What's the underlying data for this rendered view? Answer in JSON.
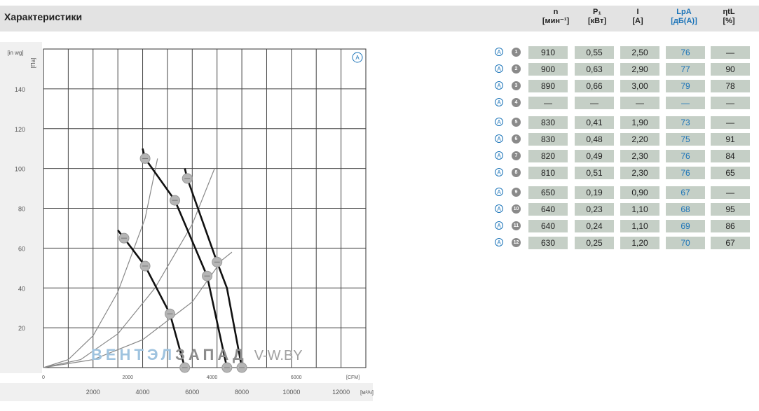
{
  "header": {
    "title": "Характеристики",
    "columns": [
      {
        "id": "n",
        "label": "n",
        "unit": "[мин⁻¹]",
        "color": "#222222"
      },
      {
        "id": "p1",
        "label": "P₁",
        "unit": "[кВт]",
        "color": "#222222"
      },
      {
        "id": "i",
        "label": "I",
        "unit": "[A]",
        "color": "#222222"
      },
      {
        "id": "lpa",
        "label": "LpA",
        "unit": "[дБ(A)]",
        "color": "#1a73b8"
      },
      {
        "id": "eta",
        "label": "ηtL",
        "unit": "[%]",
        "color": "#222222"
      }
    ]
  },
  "table": {
    "mark": "A",
    "rows": [
      {
        "idx": "1",
        "n": "910",
        "p1": "0,55",
        "i": "2,50",
        "lpa": "76",
        "eta": "—"
      },
      {
        "idx": "2",
        "n": "900",
        "p1": "0,63",
        "i": "2,90",
        "lpa": "77",
        "eta": "90"
      },
      {
        "idx": "3",
        "n": "890",
        "p1": "0,66",
        "i": "3,00",
        "lpa": "79",
        "eta": "78"
      },
      {
        "idx": "4",
        "n": "—",
        "p1": "—",
        "i": "—",
        "lpa": "—",
        "eta": "—"
      },
      {
        "idx": "5",
        "n": "830",
        "p1": "0,41",
        "i": "1,90",
        "lpa": "73",
        "eta": "—"
      },
      {
        "idx": "6",
        "n": "830",
        "p1": "0,48",
        "i": "2,20",
        "lpa": "75",
        "eta": "91"
      },
      {
        "idx": "7",
        "n": "820",
        "p1": "0,49",
        "i": "2,30",
        "lpa": "76",
        "eta": "84"
      },
      {
        "idx": "8",
        "n": "810",
        "p1": "0,51",
        "i": "2,30",
        "lpa": "76",
        "eta": "65"
      },
      {
        "idx": "9",
        "n": "650",
        "p1": "0,19",
        "i": "0,90",
        "lpa": "67",
        "eta": "—"
      },
      {
        "idx": "10",
        "n": "640",
        "p1": "0,23",
        "i": "1,10",
        "lpa": "68",
        "eta": "95"
      },
      {
        "idx": "11",
        "n": "640",
        "p1": "0,24",
        "i": "1,10",
        "lpa": "69",
        "eta": "86"
      },
      {
        "idx": "12",
        "n": "630",
        "p1": "0,25",
        "i": "1,20",
        "lpa": "70",
        "eta": "67"
      }
    ]
  },
  "watermark": {
    "part1": "ВЕНТЭЛ",
    "part2": "ЗАПАД",
    "part3": "V-W.BY"
  },
  "chart_data": {
    "type": "line",
    "title": "",
    "xlabel": "[м³/ч]",
    "xlabel2": "[CFM]",
    "ylabel": "[Па]",
    "ylabel2": "[in wg]",
    "badge": "A",
    "xlim": [
      0,
      13000
    ],
    "ylim": [
      0,
      160
    ],
    "y_ticks": [
      20,
      40,
      60,
      80,
      100,
      120,
      140
    ],
    "x_ticks": [
      2000,
      4000,
      6000,
      8000,
      10000,
      12000
    ],
    "x_tick_labels": [
      "2000",
      "4000",
      "6000",
      "8000",
      "10000",
      "12000"
    ],
    "cfm_ticks": [
      0,
      2000,
      4000,
      6000
    ],
    "cfm_tick_labels": [
      "0",
      "2000",
      "4000",
      "6000"
    ],
    "grid": true,
    "series": [
      {
        "points": [
          [
            3000,
            69
          ],
          [
            3250,
            65
          ],
          [
            4100,
            51
          ],
          [
            5100,
            27
          ],
          [
            5700,
            0
          ]
        ],
        "markers": [
          [
            3250,
            65
          ],
          [
            4100,
            51
          ],
          [
            5100,
            27
          ],
          [
            5700,
            0
          ]
        ],
        "marker_labels": [
          "9",
          "10",
          "11",
          "12"
        ]
      },
      {
        "points": [
          [
            4000,
            110
          ],
          [
            4100,
            105
          ],
          [
            5300,
            84
          ],
          [
            6600,
            46
          ],
          [
            7400,
            0
          ]
        ],
        "markers": [
          [
            4100,
            105
          ],
          [
            5300,
            84
          ],
          [
            6600,
            46
          ],
          [
            7400,
            0
          ]
        ],
        "marker_labels": [
          "5",
          "6",
          "7",
          "8"
        ]
      },
      {
        "points": [
          [
            5700,
            100
          ],
          [
            5800,
            95
          ],
          [
            7000,
            53
          ],
          [
            7400,
            40
          ],
          [
            8000,
            0
          ]
        ],
        "markers": [
          [
            5800,
            95
          ],
          [
            7000,
            53
          ],
          [
            8000,
            0
          ]
        ],
        "marker_labels": [
          "1",
          "2",
          "3"
        ]
      }
    ],
    "system_curves": [
      {
        "points": [
          [
            0,
            0
          ],
          [
            1000,
            4
          ],
          [
            2000,
            16
          ],
          [
            3000,
            38
          ],
          [
            4100,
            75
          ],
          [
            4600,
            105
          ]
        ]
      },
      {
        "points": [
          [
            0,
            0
          ],
          [
            1500,
            4
          ],
          [
            3000,
            17
          ],
          [
            4500,
            40
          ],
          [
            6000,
            72
          ],
          [
            6900,
            100
          ]
        ]
      },
      {
        "points": [
          [
            0,
            0
          ],
          [
            2000,
            4
          ],
          [
            4000,
            14
          ],
          [
            6000,
            33
          ],
          [
            7200,
            54
          ],
          [
            7600,
            58
          ]
        ]
      }
    ]
  }
}
